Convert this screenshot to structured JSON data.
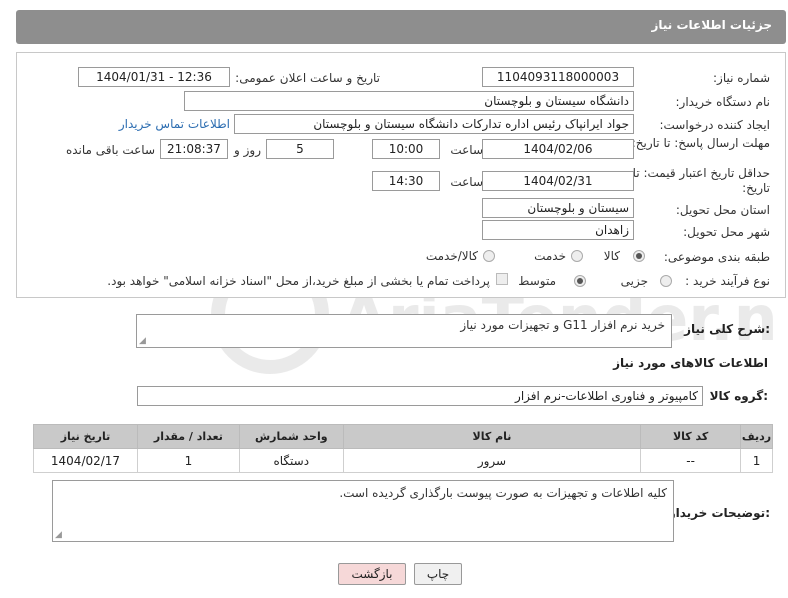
{
  "header": {
    "title": "جزئیات اطلاعات نیاز"
  },
  "form": {
    "need_number": {
      "label": "شماره نیاز:",
      "value": "1104093118000003"
    },
    "announce_datetime": {
      "label": "تاریخ و ساعت اعلان عمومی:",
      "value": "1404/01/31 - 12:36"
    },
    "buyer_org": {
      "label": "نام دستگاه خریدار:",
      "value": "دانشگاه سیستان و بلوچستان"
    },
    "requester": {
      "label": "ایجاد کننده درخواست:",
      "value": "جواد ایرانپاک رئیس اداره تدارکات دانشگاه سیستان و بلوچستان",
      "contact_link": "اطلاعات تماس خریدار"
    },
    "reply_deadline": {
      "label": "مهلت ارسال پاسخ: تا تاریخ:",
      "date": "1404/02/06",
      "time_label": "ساعت",
      "time": "10:00",
      "days": "5",
      "days_label": "روز و",
      "remaining": "21:08:37",
      "remaining_label": "ساعت باقی مانده"
    },
    "price_validity": {
      "label": "حداقل تاریخ اعتبار قیمت: تا تاریخ:",
      "date": "1404/02/31",
      "time_label": "ساعت",
      "time": "14:30"
    },
    "delivery_province": {
      "label": "استان محل تحویل:",
      "value": "سیستان و بلوچستان"
    },
    "delivery_city": {
      "label": "شهر محل تحویل:",
      "value": "زاهدان"
    },
    "category": {
      "label": "طبقه بندی موضوعی:",
      "options": [
        "کالا",
        "خدمت",
        "کالا/خدمت"
      ],
      "selected": "کالا"
    },
    "purchase_process": {
      "label": "نوع فرآیند خرید :",
      "options": [
        "جزیی",
        "متوسط"
      ],
      "selected": "متوسط",
      "payment_note": "پرداخت تمام یا بخشی از مبلغ خرید،از محل \"اسناد خزانه اسلامی\" خواهد بود."
    }
  },
  "description": {
    "label": "شرح کلی نیاز:",
    "value": "خرید نرم افزار G11 و تجهیزات مورد نیاز"
  },
  "goods_info": {
    "title": "اطلاعات کالاهای مورد نیاز",
    "group_label": "گروه کالا:",
    "group_value": "کامپیوتر و فناوری اطلاعات-نرم افزار",
    "table": {
      "headers": [
        "ردیف",
        "کد کالا",
        "نام کالا",
        "واحد شمارش",
        "تعداد / مقدار",
        "تاریخ نیاز"
      ],
      "rows": [
        [
          "1",
          "--",
          "سرور",
          "دستگاه",
          "1",
          "1404/02/17"
        ]
      ]
    }
  },
  "buyer_notes": {
    "label": "توضیحات خریدار:",
    "value": "کلیه اطلاعات و تجهیزات به صورت پیوست بارگذاری گردیده است."
  },
  "buttons": {
    "print": "چاپ",
    "back": "بازگشت"
  },
  "watermark": {
    "text": "AriaTender.net"
  },
  "colors": {
    "header_bg": "#8e8e8e",
    "link": "#2c6db1",
    "back_button": "#f6d8d8",
    "table_header": "#c9c9c9"
  }
}
